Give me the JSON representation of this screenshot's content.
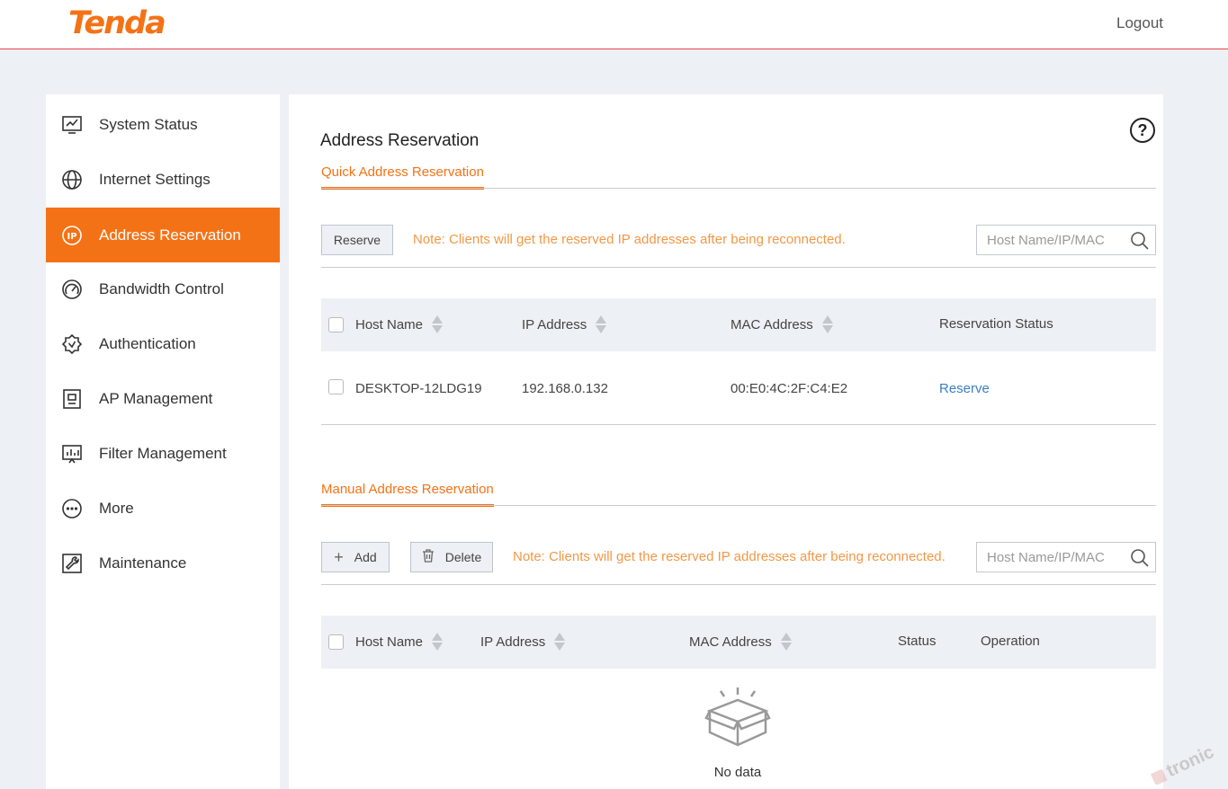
{
  "header": {
    "logo": "Tenda",
    "logout": "Logout"
  },
  "sidebar": {
    "items": [
      {
        "label": "System Status",
        "icon": "system-status-icon"
      },
      {
        "label": "Internet Settings",
        "icon": "globe-icon"
      },
      {
        "label": "Address Reservation",
        "icon": "ip-icon",
        "active": true
      },
      {
        "label": "Bandwidth Control",
        "icon": "gauge-icon"
      },
      {
        "label": "Authentication",
        "icon": "badge-check-icon"
      },
      {
        "label": "AP Management",
        "icon": "access-point-icon"
      },
      {
        "label": "Filter Management",
        "icon": "filter-chart-icon"
      },
      {
        "label": "More",
        "icon": "more-icon"
      },
      {
        "label": "Maintenance",
        "icon": "wrench-icon"
      }
    ]
  },
  "main": {
    "title": "Address Reservation",
    "help": "?",
    "quick": {
      "tab": "Quick Address Reservation",
      "reserve_button": "Reserve",
      "note": "Note: Clients will get the reserved IP addresses after being reconnected.",
      "search_placeholder": "Host Name/IP/MAC",
      "columns": [
        "Host Name",
        "IP Address",
        "MAC Address",
        "Reservation Status"
      ],
      "rows": [
        {
          "host": "DESKTOP-12LDG19",
          "ip": "192.168.0.132",
          "mac": "00:E0:4C:2F:C4:E2",
          "status": "Reserve"
        }
      ]
    },
    "manual": {
      "tab": "Manual Address Reservation",
      "add_button": "Add",
      "delete_button": "Delete",
      "note": "Note: Clients will get the reserved IP addresses after being reconnected.",
      "search_placeholder": "Host Name/IP/MAC",
      "columns": [
        "Host Name",
        "IP Address",
        "MAC Address",
        "Status",
        "Operation"
      ],
      "empty_text": "No data"
    }
  },
  "colors": {
    "accent": "#f47216",
    "note": "#f29846",
    "link": "#3a7fc1",
    "header_rule": "#e8424a"
  },
  "watermark": {
    "text": "tronic"
  }
}
